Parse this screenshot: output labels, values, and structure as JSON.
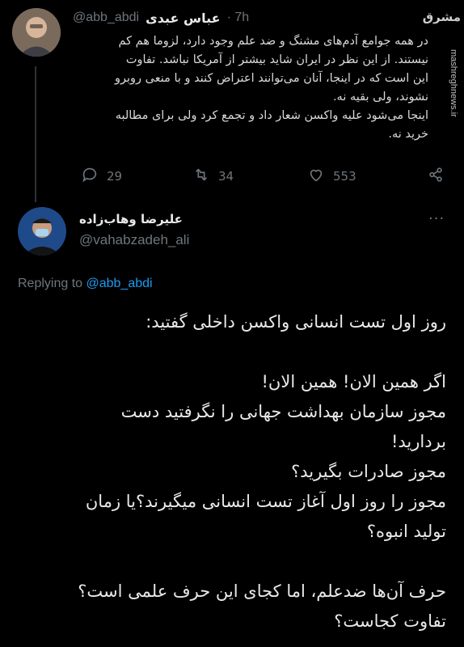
{
  "tweet1": {
    "display_name": "عباس عبدی",
    "handle": "@abb_abdi",
    "time": "· 7h",
    "lines": [
      "در همه جوامع آدم‌های مشنگ و ضد علم وجود دارد، لزوما هم کم",
      "نیستند. از این نظر در ایران شاید بیشتر از آمریکا نباشد. تفاوت",
      "این است که در اینجا، آنان می‌توانند اعتراض کنند و با منعی روبرو",
      "نشوند، ولی بقیه نه.",
      "اینجا می‌شود علیه واکسن شعار داد و تجمع کرد ولی برای مطالبه",
      "خرید نه."
    ],
    "replies": "29",
    "retweets": "34",
    "likes": "553"
  },
  "tweet2": {
    "display_name": "علیرضا وهاب‌زاده",
    "handle": "@vahabzadeh_ali",
    "replying_prefix": "Replying to",
    "replying_handle": "@abb_abdi",
    "lines": [
      "روز اول تست انسانی واکسن داخلی گفتید:",
      "",
      "اگر همین الان! همین الان!",
      "مجوز سازمان بهداشت جهانی را نگرفتید دست",
      "بردارید!",
      "مجوز صادرات بگیرید؟",
      "مجوز را روز اول آغاز تست انسانی میگیرند؟یا زمان",
      "تولید انبوه؟",
      "",
      "حرف آن‌ها ضدعلم، اما کجای این حرف علمی است؟",
      "تفاوت کجاست؟"
    ]
  },
  "watermark": {
    "logo_text": "مشرق",
    "vertical_text": "mashreghnews.ir"
  },
  "colors": {
    "background": "#000000",
    "text": "#d9d9d9",
    "muted": "#6e767d",
    "link": "#1d9bf0",
    "divider": "#2f3336"
  }
}
